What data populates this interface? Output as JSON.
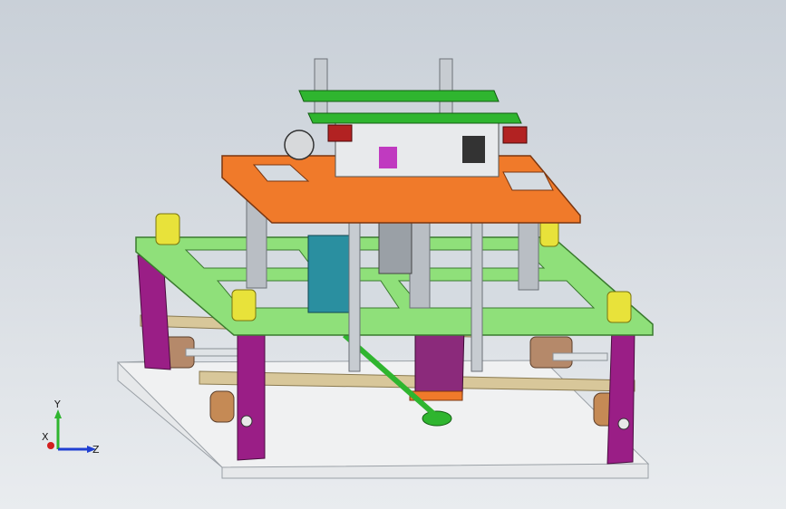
{
  "viewport": {
    "background_top": "#c9d0d8",
    "background_bottom": "#e9ecef"
  },
  "model": {
    "colors": {
      "base_plate": "#e6e8ea",
      "frame": "#8fe07a",
      "legs": "#9a1e86",
      "top_plate": "#f07a2a",
      "rods": "#b9bec4",
      "spacers": "#e8e23a",
      "rails": "#d8c79a",
      "belt": "#2fb52f",
      "block": "#2a8fa0"
    }
  },
  "triad": {
    "y_label": "Y",
    "x_label": "X",
    "z_label": "Z",
    "y_color": "#2fb52f",
    "x_color": "#d21f1f",
    "z_color": "#1f3fd2"
  }
}
